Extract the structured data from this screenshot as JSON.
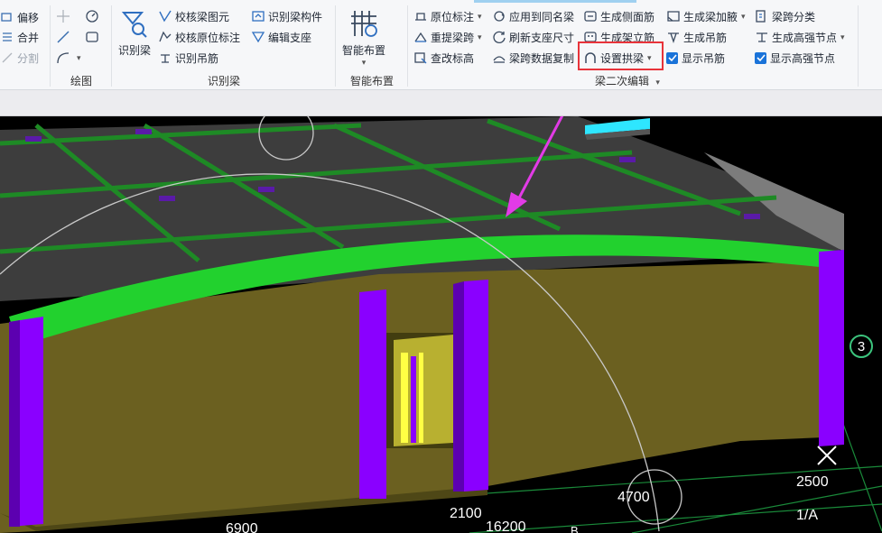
{
  "ribbon": {
    "edit_left": {
      "offset": "偏移",
      "merge": "合并",
      "split": "分割"
    },
    "draw": {
      "label": "绘图"
    },
    "identify_beam": {
      "label": "识别梁",
      "big": "识别梁",
      "check_beam_element": "校核梁图元",
      "check_original_annotation": "校核原位标注",
      "identify_hanger_rebar": "识别吊筋",
      "identify_beam_component": "识别梁构件",
      "edit_support": "编辑支座"
    },
    "smart_layout": {
      "label": "智能布置",
      "big": "智能布置"
    },
    "beam_secondary_edit": {
      "label": "梁二次编辑",
      "original_annotation": "原位标注",
      "reextract_span": "重提梁跨",
      "modify_elevation": "查改标高",
      "apply_same_name": "应用到同名梁",
      "refresh_support_size": "刷新支座尺寸",
      "copy_span_data": "梁跨数据复制",
      "gen_side_rebar": "生成侧面筋",
      "gen_erect_rebar": "生成架立筋",
      "set_arch_beam": "设置拱梁",
      "gen_haunch": "生成梁加腋",
      "gen_hanger": "生成吊筋",
      "show_hanger": "显示吊筋",
      "span_classify": "梁跨分类",
      "gen_high_strength_node": "生成高强节点",
      "show_high_strength_node": "显示高强节点"
    }
  },
  "viewport": {
    "dimensions": [
      "6900",
      "2100",
      "16200",
      "4700",
      "2500"
    ],
    "axis_label": "1/A",
    "axis_badge": "3",
    "axis_b": "B"
  },
  "colors": {
    "arch_beam": "#22d12e",
    "column": "#8a00ff",
    "wall": "#6b6020",
    "slab": "#3c3c3c",
    "highlight": "#e8333a",
    "arrow": "#e23be6"
  }
}
